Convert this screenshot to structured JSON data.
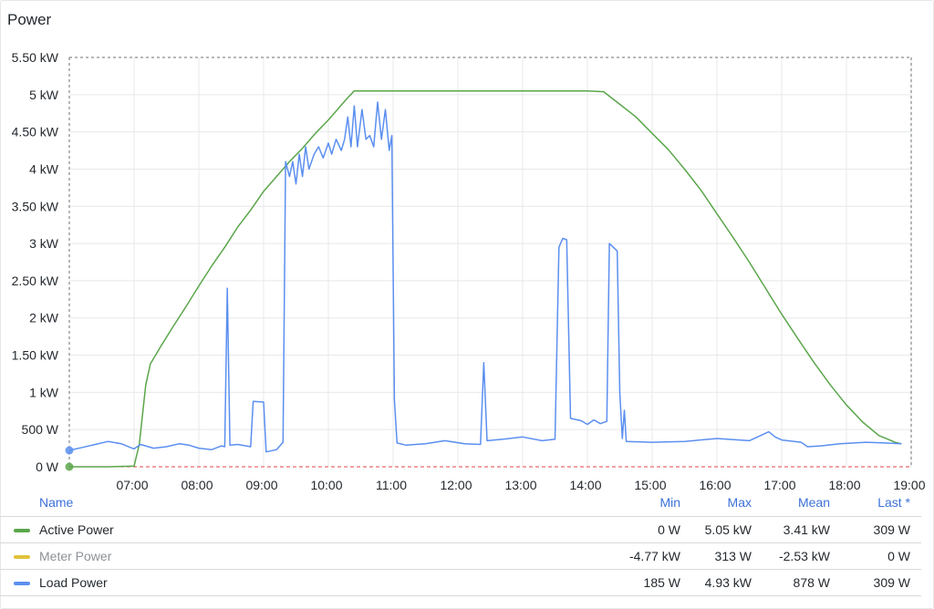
{
  "panel": {
    "title": "Power"
  },
  "colors": {
    "active": "#5aa64b",
    "meter": "#e0c23a",
    "load": "#5b8ff0",
    "threshold": "#e0464e",
    "grid": "#e7e8ea",
    "header_blue": "#3d71d9"
  },
  "legend": {
    "headers": {
      "name": "Name",
      "min": "Min",
      "max": "Max",
      "mean": "Mean",
      "last": "Last *"
    },
    "rows": [
      {
        "name": "Active Power",
        "min": "0 W",
        "max": "5.05 kW",
        "mean": "3.41 kW",
        "last": "309 W",
        "color": "#5aa64b",
        "muted": false
      },
      {
        "name": "Meter Power",
        "min": "-4.77 kW",
        "max": "313 W",
        "mean": "-2.53 kW",
        "last": "0 W",
        "color": "#e0c23a",
        "muted": true
      },
      {
        "name": "Load Power",
        "min": "185 W",
        "max": "4.93 kW",
        "mean": "878 W",
        "last": "309 W",
        "color": "#5b8ff0",
        "muted": false
      }
    ]
  },
  "chart_data": {
    "type": "line",
    "x_unit": "hour of day",
    "xlim": [
      6.0,
      19.0
    ],
    "ylim": [
      0,
      5500
    ],
    "grid": true,
    "legend_position": "bottom",
    "x_ticks": [
      {
        "v": 7,
        "label": "07:00"
      },
      {
        "v": 8,
        "label": "08:00"
      },
      {
        "v": 9,
        "label": "09:00"
      },
      {
        "v": 10,
        "label": "10:00"
      },
      {
        "v": 11,
        "label": "11:00"
      },
      {
        "v": 12,
        "label": "12:00"
      },
      {
        "v": 13,
        "label": "13:00"
      },
      {
        "v": 14,
        "label": "14:00"
      },
      {
        "v": 15,
        "label": "15:00"
      },
      {
        "v": 16,
        "label": "16:00"
      },
      {
        "v": 17,
        "label": "17:00"
      },
      {
        "v": 18,
        "label": "18:00"
      },
      {
        "v": 19,
        "label": "19:00"
      }
    ],
    "y_ticks": [
      {
        "v": 0,
        "label": "0 W"
      },
      {
        "v": 500,
        "label": "500 W"
      },
      {
        "v": 1000,
        "label": "1 kW"
      },
      {
        "v": 1500,
        "label": "1.50 kW"
      },
      {
        "v": 2000,
        "label": "2 kW"
      },
      {
        "v": 2500,
        "label": "2.50 kW"
      },
      {
        "v": 3000,
        "label": "3 kW"
      },
      {
        "v": 3500,
        "label": "3.50 kW"
      },
      {
        "v": 4000,
        "label": "4 kW"
      },
      {
        "v": 4500,
        "label": "4.50 kW"
      },
      {
        "v": 5000,
        "label": "5 kW"
      },
      {
        "v": 5500,
        "label": "5.50 kW"
      }
    ],
    "series": [
      {
        "name": "Active Power",
        "color": "#5aa64b",
        "points": [
          [
            6.0,
            0
          ],
          [
            6.6,
            0
          ],
          [
            7.0,
            10
          ],
          [
            7.08,
            300
          ],
          [
            7.18,
            1100
          ],
          [
            7.25,
            1380
          ],
          [
            7.4,
            1600
          ],
          [
            7.6,
            1880
          ],
          [
            7.8,
            2150
          ],
          [
            8.0,
            2430
          ],
          [
            8.2,
            2700
          ],
          [
            8.4,
            2950
          ],
          [
            8.6,
            3220
          ],
          [
            8.8,
            3450
          ],
          [
            9.0,
            3700
          ],
          [
            9.2,
            3900
          ],
          [
            9.4,
            4100
          ],
          [
            9.6,
            4280
          ],
          [
            9.8,
            4480
          ],
          [
            10.0,
            4660
          ],
          [
            10.2,
            4860
          ],
          [
            10.3,
            4960
          ],
          [
            10.4,
            5050
          ],
          [
            10.6,
            5050
          ],
          [
            11.0,
            5050
          ],
          [
            12.0,
            5050
          ],
          [
            13.0,
            5050
          ],
          [
            14.0,
            5050
          ],
          [
            14.25,
            5040
          ],
          [
            14.5,
            4870
          ],
          [
            14.75,
            4700
          ],
          [
            15.0,
            4480
          ],
          [
            15.25,
            4260
          ],
          [
            15.5,
            4000
          ],
          [
            15.75,
            3720
          ],
          [
            16.0,
            3400
          ],
          [
            16.25,
            3080
          ],
          [
            16.5,
            2750
          ],
          [
            16.75,
            2400
          ],
          [
            17.0,
            2050
          ],
          [
            17.25,
            1720
          ],
          [
            17.5,
            1400
          ],
          [
            17.75,
            1100
          ],
          [
            18.0,
            830
          ],
          [
            18.25,
            600
          ],
          [
            18.5,
            420
          ],
          [
            18.75,
            330
          ],
          [
            18.85,
            309
          ]
        ]
      },
      {
        "name": "Meter Power",
        "color": "#e0c23a",
        "points": []
      },
      {
        "name": "Load Power",
        "color": "#5b8ff0",
        "points": [
          [
            6.0,
            220
          ],
          [
            6.2,
            260
          ],
          [
            6.4,
            300
          ],
          [
            6.6,
            340
          ],
          [
            6.8,
            310
          ],
          [
            7.0,
            240
          ],
          [
            7.1,
            300
          ],
          [
            7.3,
            250
          ],
          [
            7.5,
            270
          ],
          [
            7.7,
            310
          ],
          [
            7.85,
            290
          ],
          [
            8.0,
            250
          ],
          [
            8.2,
            230
          ],
          [
            8.35,
            280
          ],
          [
            8.4,
            270
          ],
          [
            8.44,
            2400
          ],
          [
            8.48,
            290
          ],
          [
            8.6,
            300
          ],
          [
            8.8,
            270
          ],
          [
            8.84,
            880
          ],
          [
            9.0,
            870
          ],
          [
            9.04,
            200
          ],
          [
            9.2,
            230
          ],
          [
            9.3,
            330
          ],
          [
            9.34,
            4100
          ],
          [
            9.4,
            3900
          ],
          [
            9.45,
            4100
          ],
          [
            9.5,
            3800
          ],
          [
            9.55,
            4200
          ],
          [
            9.6,
            3900
          ],
          [
            9.65,
            4300
          ],
          [
            9.7,
            4000
          ],
          [
            9.78,
            4200
          ],
          [
            9.85,
            4300
          ],
          [
            9.92,
            4150
          ],
          [
            10.0,
            4350
          ],
          [
            10.05,
            4200
          ],
          [
            10.12,
            4400
          ],
          [
            10.2,
            4250
          ],
          [
            10.25,
            4400
          ],
          [
            10.3,
            4700
          ],
          [
            10.35,
            4300
          ],
          [
            10.4,
            4850
          ],
          [
            10.45,
            4300
          ],
          [
            10.52,
            4800
          ],
          [
            10.58,
            4400
          ],
          [
            10.64,
            4450
          ],
          [
            10.7,
            4300
          ],
          [
            10.76,
            4900
          ],
          [
            10.82,
            4400
          ],
          [
            10.88,
            4800
          ],
          [
            10.94,
            4250
          ],
          [
            10.98,
            4450
          ],
          [
            11.02,
            900
          ],
          [
            11.06,
            320
          ],
          [
            11.2,
            290
          ],
          [
            11.5,
            310
          ],
          [
            11.8,
            350
          ],
          [
            12.1,
            310
          ],
          [
            12.35,
            300
          ],
          [
            12.4,
            1400
          ],
          [
            12.45,
            350
          ],
          [
            12.7,
            370
          ],
          [
            13.0,
            400
          ],
          [
            13.3,
            350
          ],
          [
            13.5,
            370
          ],
          [
            13.56,
            2950
          ],
          [
            13.62,
            3070
          ],
          [
            13.68,
            3050
          ],
          [
            13.74,
            650
          ],
          [
            13.9,
            620
          ],
          [
            14.0,
            570
          ],
          [
            14.1,
            630
          ],
          [
            14.2,
            580
          ],
          [
            14.3,
            610
          ],
          [
            14.34,
            3000
          ],
          [
            14.4,
            2950
          ],
          [
            14.46,
            2900
          ],
          [
            14.5,
            1000
          ],
          [
            14.54,
            380
          ],
          [
            14.57,
            760
          ],
          [
            14.6,
            340
          ],
          [
            15.0,
            330
          ],
          [
            15.5,
            340
          ],
          [
            16.0,
            380
          ],
          [
            16.5,
            350
          ],
          [
            16.7,
            430
          ],
          [
            16.8,
            470
          ],
          [
            16.9,
            400
          ],
          [
            17.0,
            360
          ],
          [
            17.3,
            330
          ],
          [
            17.4,
            270
          ],
          [
            17.6,
            280
          ],
          [
            17.9,
            310
          ],
          [
            18.3,
            330
          ],
          [
            18.6,
            320
          ],
          [
            18.85,
            309
          ]
        ]
      }
    ]
  }
}
